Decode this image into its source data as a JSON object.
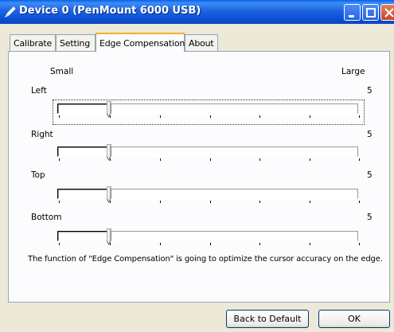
{
  "window": {
    "title": "Device 0 (PenMount 6000 USB)"
  },
  "tabs": [
    {
      "label": "Calibrate",
      "active": false
    },
    {
      "label": "Setting",
      "active": false
    },
    {
      "label": "Edge Compensation",
      "active": true
    },
    {
      "label": "About",
      "active": false
    }
  ],
  "scale": {
    "small_label": "Small",
    "large_label": "Large"
  },
  "sliders": [
    {
      "label": "Left",
      "value": "5"
    },
    {
      "label": "Right",
      "value": "5"
    },
    {
      "label": "Top",
      "value": "5"
    },
    {
      "label": "Bottom",
      "value": "5"
    }
  ],
  "description": "The function of \"Edge Compensation\" is going to optimize the cursor accuracy on the edge.",
  "buttons": {
    "back_to_default": "Back to Default",
    "ok": "OK"
  },
  "colors": {
    "titlebar": "#0A5FE8",
    "dialog_bg": "#ECE9D8",
    "tab_highlight": "#F2B030"
  }
}
